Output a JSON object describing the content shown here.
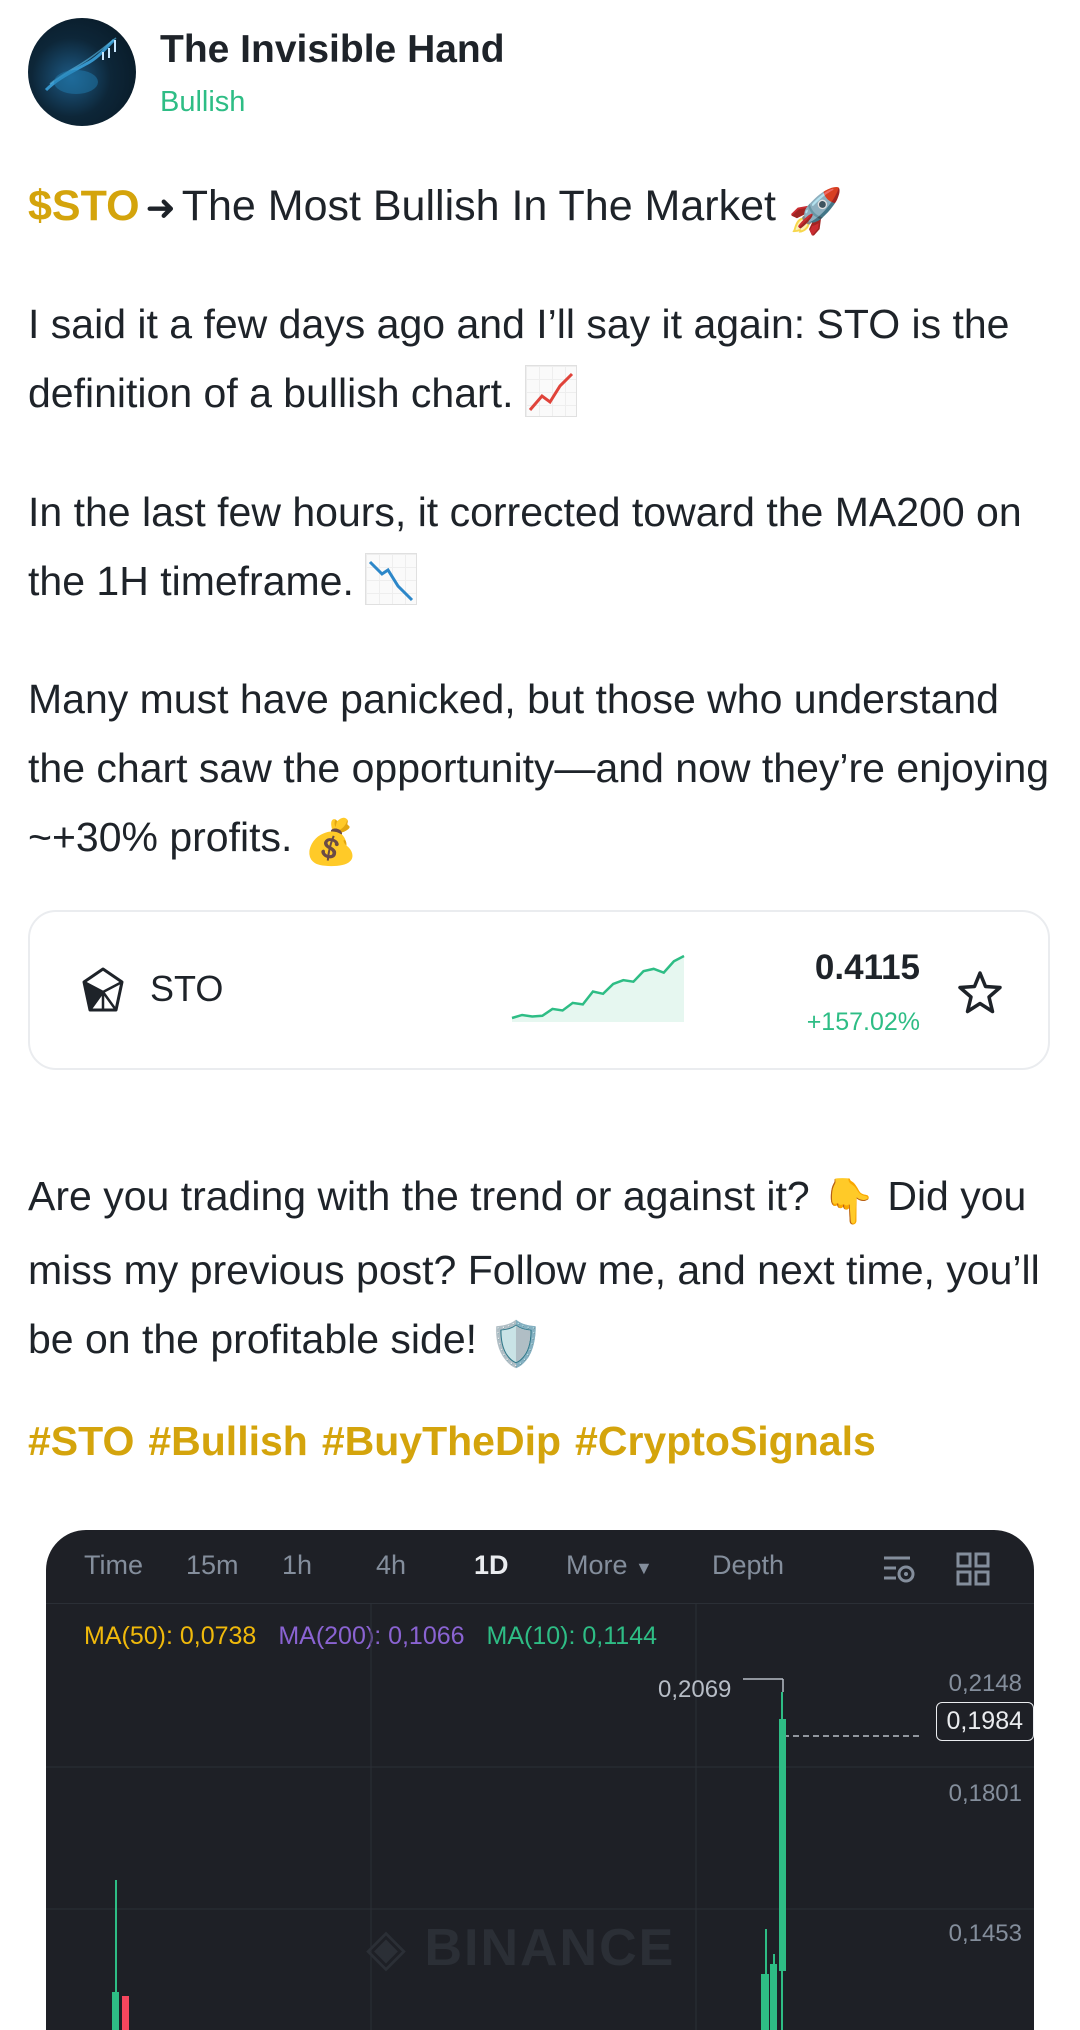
{
  "author": {
    "name": "The Invisible Hand",
    "sentiment": "Bullish"
  },
  "post": {
    "title_ticker": "$STO",
    "title_arrow": "➜",
    "title_text": "The Most Bullish In The Market",
    "title_emoji": "🚀",
    "p1_text": "I said it a few days ago and I’ll say it again: STO is the definition of a bullish chart.",
    "p1_emoji": "chart-increasing-icon",
    "p2_text": "In the last few hours, it corrected toward the MA200 on the 1H timeframe.",
    "p2_emoji": "chart-decreasing-icon",
    "p3_text": "Many must have panicked, but those who understand the chart saw the opportunity—and now they’re enjoying ~+30% profits.",
    "p3_emoji": "💰",
    "p4_line1": "Are you trading with the trend or against it?",
    "p4_emoji1": "👇",
    "p4_line2": "Did you miss my previous post? Follow me, and next time, you’ll be on the profitable side!",
    "p4_emoji2": "🛡️"
  },
  "coin_card": {
    "symbol": "STO",
    "price": "0.4115",
    "change": "+157.02%",
    "change_color": "#2ebd85",
    "sparkline": [
      0.1,
      0.14,
      0.12,
      0.13,
      0.22,
      0.2,
      0.3,
      0.28,
      0.45,
      0.42,
      0.55,
      0.6,
      0.58,
      0.72,
      0.75,
      0.7,
      0.85,
      0.92
    ]
  },
  "hashtags": [
    "#STO",
    "#Bullish",
    "#BuyTheDip",
    "#CryptoSignals"
  ],
  "chart_widget": {
    "tabs": [
      "Time",
      "15m",
      "1h",
      "4h",
      "1D",
      "More",
      "Depth"
    ],
    "active_tab": "1D",
    "ma50": "MA(50): 0,0738",
    "ma200": "MA(200): 0,1066",
    "ma10": "MA(10): 0,1144",
    "y_labels": [
      "0,2148",
      "0,1801",
      "0,1453"
    ],
    "current_price": "0,1984",
    "high_label": "0,2069",
    "watermark": "BINANCE"
  },
  "colors": {
    "accent": "#d4a40c",
    "up": "#2ebd85",
    "down": "#f6465d",
    "ma50": "#f0b90b",
    "ma200": "#8a63d2"
  }
}
